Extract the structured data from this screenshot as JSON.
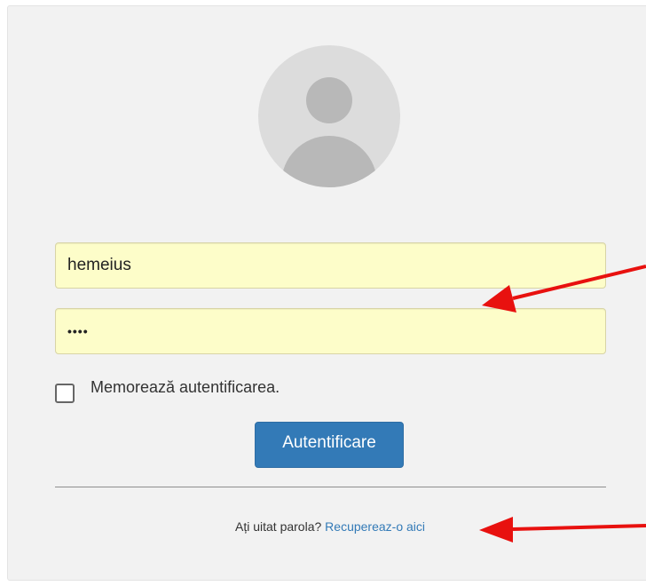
{
  "login": {
    "username_value": "hemeius",
    "password_value": "••••",
    "remember_label": "Memorează autentificarea.",
    "submit_label": "Autentificare",
    "forgot_text": "Ați uitat parola?",
    "recover_link": "Recupereaz-o aici"
  },
  "colors": {
    "panel": "#f2f2f2",
    "autofill": "#fdfdc9",
    "primary": "#337ab7",
    "annotation_arrow": "#e8110f"
  },
  "icons": {
    "avatar": "user-avatar-icon",
    "checkbox": "checkbox-unchecked-icon",
    "annotation": "red-arrow-icon"
  }
}
